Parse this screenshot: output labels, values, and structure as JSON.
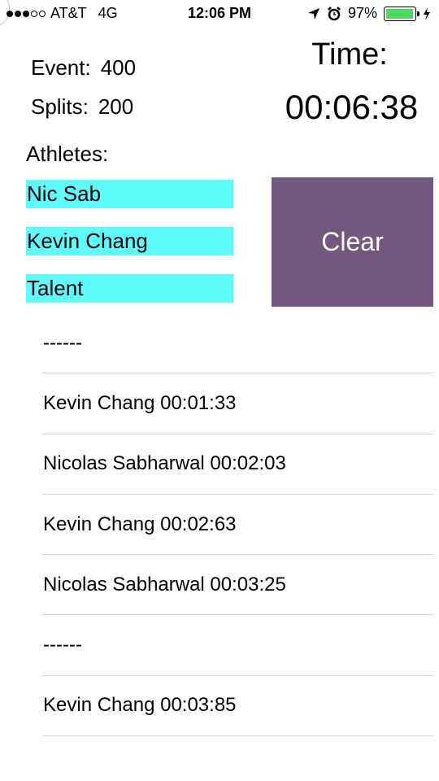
{
  "status_bar": {
    "carrier": "AT&T",
    "network": "4G",
    "time": "12:06 PM",
    "battery_percent_label": "97%",
    "battery_level": 0.97,
    "signal_bars_filled": 3,
    "signal_bars_total": 5
  },
  "event": {
    "label": "Event:",
    "value": "400"
  },
  "splits": {
    "label": "Splits:",
    "value": "200"
  },
  "timer": {
    "label": "Time:",
    "value": "00:06:38"
  },
  "athletes_title": "Athletes:",
  "athletes": [
    "Nic Sab",
    "Kevin Chang",
    "Talent"
  ],
  "clear_label": "Clear",
  "split_entries": [
    "------",
    "Kevin Chang 00:01:33",
    "Nicolas Sabharwal 00:02:03",
    "Kevin Chang 00:02:63",
    "Nicolas Sabharwal 00:03:25",
    "------",
    "Kevin Chang 00:03:85"
  ],
  "colors": {
    "athlete_field_bg": "#5ffcfc",
    "clear_button_bg": "#73577f",
    "battery_fill": "#4cd964"
  }
}
